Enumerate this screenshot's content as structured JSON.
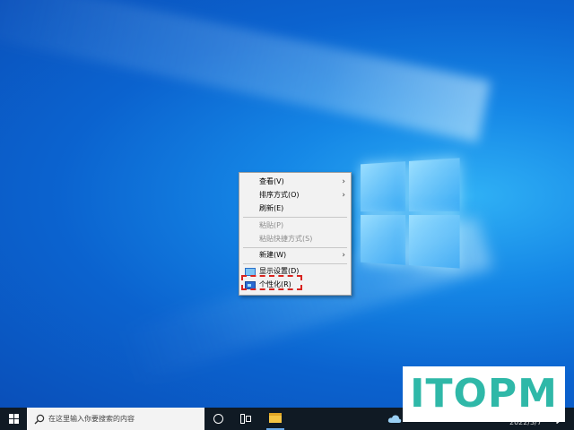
{
  "context_menu": {
    "items": [
      {
        "label": "查看(V)",
        "has_submenu": true,
        "disabled": false
      },
      {
        "label": "排序方式(O)",
        "has_submenu": true,
        "disabled": false
      },
      {
        "label": "刷新(E)",
        "has_submenu": false,
        "disabled": false
      },
      {
        "label": "粘贴(P)",
        "has_submenu": false,
        "disabled": true
      },
      {
        "label": "粘贴快捷方式(S)",
        "has_submenu": false,
        "disabled": true
      },
      {
        "label": "新建(W)",
        "has_submenu": true,
        "disabled": false
      },
      {
        "label": "显示设置(D)",
        "has_submenu": false,
        "disabled": false,
        "icon": "display-icon"
      },
      {
        "label": "个性化(R)",
        "has_submenu": false,
        "disabled": false,
        "icon": "personalize-icon",
        "highlighted": true
      }
    ],
    "submenu_arrow": "›"
  },
  "taskbar": {
    "search_placeholder": "在这里输入你要搜索的内容",
    "date": "2022/3/7",
    "icons": [
      "windows-start-icon",
      "search-icon",
      "cortana-icon",
      "task-view-icon",
      "file-explorer-icon",
      "weather-icon",
      "notification-icon"
    ]
  },
  "watermark": {
    "text": "ITOPM"
  },
  "colors": {
    "highlight_border": "#d8231f",
    "watermark_text": "#2fb8a8",
    "taskbar_bg": "#101a24"
  }
}
